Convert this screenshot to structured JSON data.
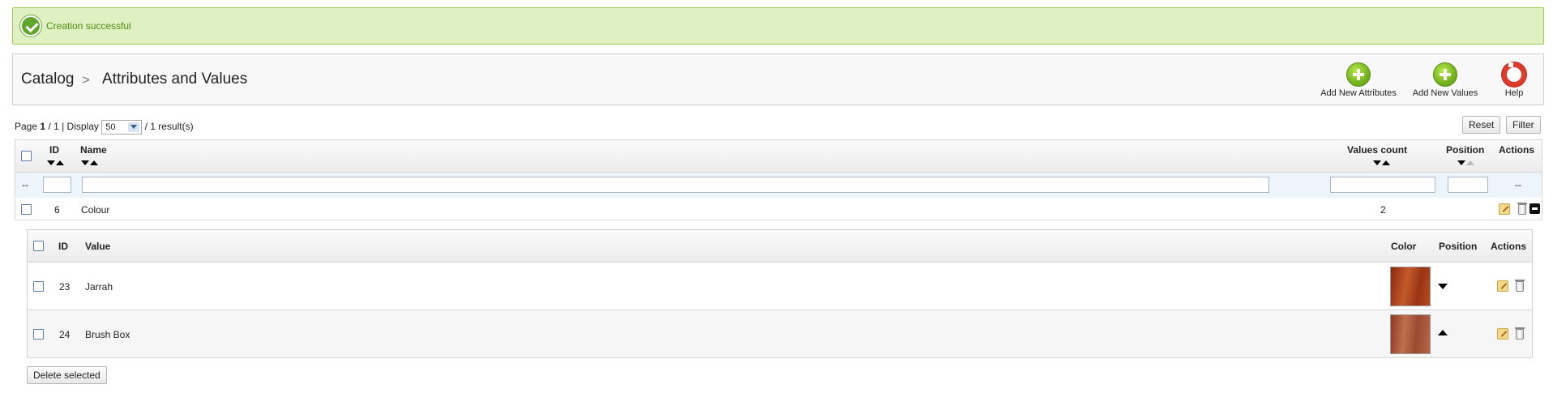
{
  "alert": {
    "message": "Creation successful"
  },
  "toolbar": {
    "breadcrumb": [
      "Catalog",
      "Attributes and Values"
    ],
    "separator": ">",
    "buttons": [
      {
        "label": "Add New Attributes",
        "icon": "add-icon"
      },
      {
        "label": "Add New Values",
        "icon": "add-icon"
      },
      {
        "label": "Help",
        "icon": "help-lifebuoy-icon"
      }
    ]
  },
  "paging": {
    "page_prefix": "Page",
    "current_page": "1",
    "total_text": "/ 1 | Display",
    "per_page": "50",
    "results_text": "/ 1 result(s)",
    "reset_label": "Reset",
    "filter_label": "Filter"
  },
  "table": {
    "columns": {
      "id": "ID",
      "name": "Name",
      "values_count": "Values count",
      "position": "Position",
      "actions": "Actions"
    },
    "filter_placeholder_text": "--",
    "actions_placeholder": "--",
    "rows": [
      {
        "id": "6",
        "name": "Colour",
        "values_count": "2"
      }
    ]
  },
  "values_table": {
    "columns": {
      "id": "ID",
      "value": "Value",
      "color": "Color",
      "position": "Position",
      "actions": "Actions"
    },
    "rows": [
      {
        "id": "23",
        "value": "Jarrah",
        "swatch": "#a8401d",
        "position_arrow": "down"
      },
      {
        "id": "24",
        "value": "Brush Box",
        "swatch": "#a9553a",
        "position_arrow": "up"
      }
    ]
  },
  "footer": {
    "delete_label": "Delete selected"
  }
}
